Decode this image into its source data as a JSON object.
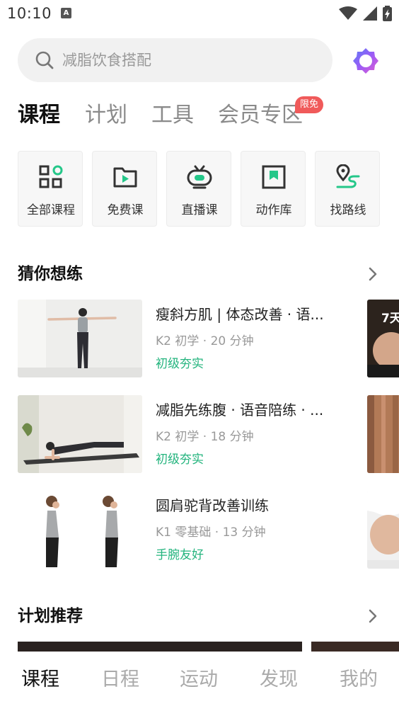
{
  "status_bar": {
    "time": "10:10",
    "notification_letter": "A"
  },
  "search": {
    "placeholder": "减脂饮食搭配"
  },
  "top_tabs": [
    {
      "label": "课程",
      "active": true
    },
    {
      "label": "计划",
      "active": false
    },
    {
      "label": "工具",
      "active": false
    },
    {
      "label": "会员专区",
      "active": false
    }
  ],
  "badge": "限免",
  "tools": [
    {
      "label": "全部课程",
      "icon": "grid-icon"
    },
    {
      "label": "免费课",
      "icon": "folder-play-icon"
    },
    {
      "label": "直播课",
      "icon": "live-tv-icon"
    },
    {
      "label": "动作库",
      "icon": "bookmark-square-icon"
    },
    {
      "label": "找路线",
      "icon": "route-pin-icon"
    }
  ],
  "guess_section": {
    "title": "猜你想练"
  },
  "courses": [
    {
      "title": "瘦斜方肌 | 体态改善 · 语...",
      "meta": "K2 初学 · 20 分钟",
      "tag": "初级夯实"
    },
    {
      "title": "减脂先练腹 · 语音陪练 · ...",
      "meta": "K2 初学 · 18 分钟",
      "tag": "初级夯实"
    },
    {
      "title": "圆肩驼背改善训练",
      "meta": "K1 零基础 · 13 分钟",
      "tag": "手腕友好"
    }
  ],
  "peek_label": "7天",
  "plan_section": {
    "title": "计划推荐"
  },
  "bottom_nav": [
    {
      "label": "课程",
      "active": true
    },
    {
      "label": "日程",
      "active": false
    },
    {
      "label": "运动",
      "active": false
    },
    {
      "label": "发现",
      "active": false
    },
    {
      "label": "我的",
      "active": false
    }
  ],
  "colors": {
    "accent": "#24c789",
    "tag_green": "#24b47e",
    "badge_red": "#f05a5a",
    "ai_purple": "#8a5cf6"
  }
}
